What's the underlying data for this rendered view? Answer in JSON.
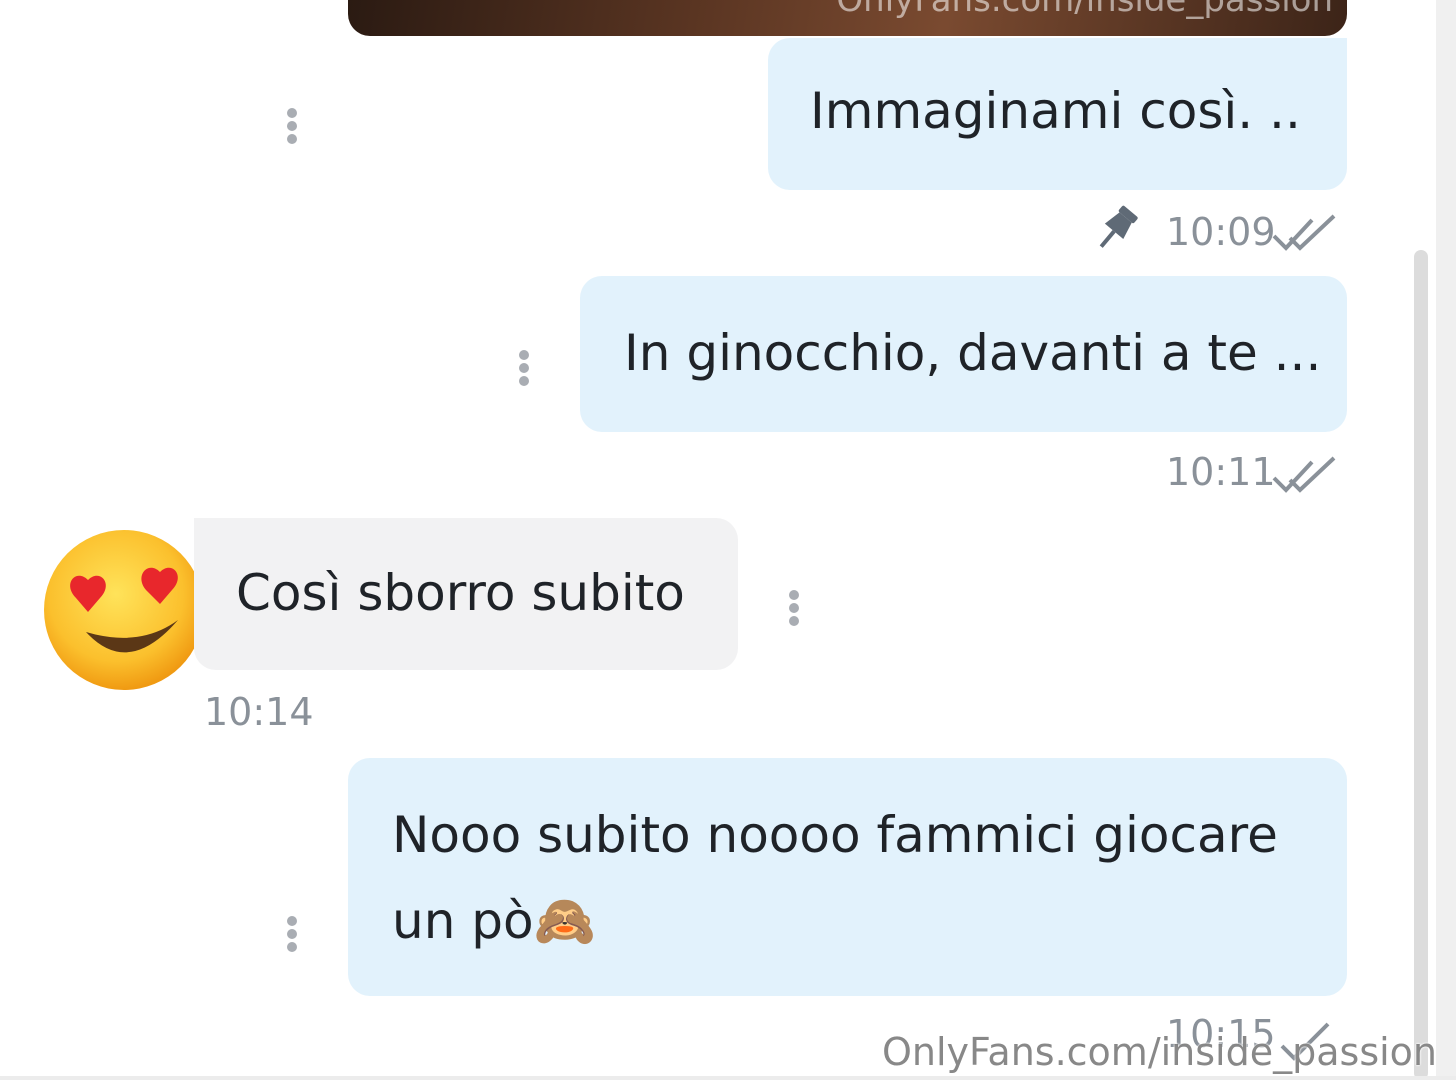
{
  "media_preview": {
    "watermark": "OnlyFans.com/inside_passion"
  },
  "messages": [
    {
      "direction": "out",
      "text": "Immaginami così. ..",
      "time": "10:09",
      "pinned": true,
      "status": "read"
    },
    {
      "direction": "out",
      "text": "In ginocchio, davanti a te ...",
      "time": "10:11",
      "status": "read"
    },
    {
      "direction": "in",
      "text": "Così sborro subito",
      "time": "10:14",
      "avatar": "heart-eyes-emoji"
    },
    {
      "direction": "out",
      "text_line1": "Nooo subito noooo fammici giocare",
      "text_line2": "un pò🙈",
      "time": "10:15",
      "status": "sent"
    }
  ],
  "watermark": "OnlyFans.com/inside_passion",
  "icons": {
    "more": "vertical-dots-icon",
    "pin": "pin-icon",
    "read": "double-check-icon",
    "sent": "single-check-icon"
  },
  "colors": {
    "outgoing_bubble": "#e2f2fc",
    "incoming_bubble": "#f2f2f3",
    "meta_text": "#8a9199"
  }
}
